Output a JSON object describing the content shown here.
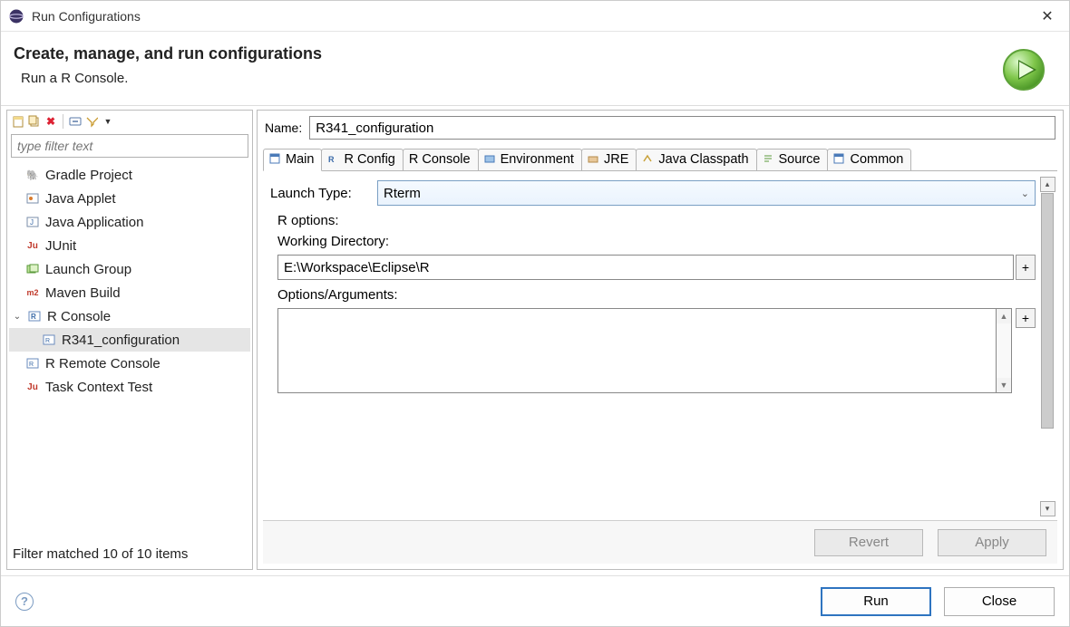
{
  "window": {
    "title": "Run Configurations"
  },
  "header": {
    "title": "Create, manage, and run configurations",
    "subtitle": "Run a R Console."
  },
  "filter": {
    "placeholder": "type filter text",
    "status": "Filter matched 10 of 10 items"
  },
  "tree": {
    "items": [
      {
        "label": "Gradle Project"
      },
      {
        "label": "Java Applet"
      },
      {
        "label": "Java Application"
      },
      {
        "label": "JUnit"
      },
      {
        "label": "Launch Group"
      },
      {
        "label": "Maven Build"
      },
      {
        "label": "R Console",
        "expanded": true,
        "children": [
          {
            "label": "R341_configuration",
            "selected": true
          }
        ]
      },
      {
        "label": "R Remote Console"
      },
      {
        "label": "Task Context Test"
      }
    ]
  },
  "name": {
    "label": "Name:",
    "value": "R341_configuration"
  },
  "tabs": [
    "Main",
    "R Config",
    "R Console",
    "Environment",
    "JRE",
    "Java Classpath",
    "Source",
    "Common"
  ],
  "activeTab": "Main",
  "main": {
    "launchTypeLabel": "Launch Type:",
    "launchTypeValue": "Rterm",
    "rOptionsLabel": "R options:",
    "workingDirLabel": "Working Directory:",
    "workingDirValue": "E:\\Workspace\\Eclipse\\R",
    "optionsArgsLabel": "Options/Arguments:",
    "optionsArgsValue": ""
  },
  "buttons": {
    "revert": "Revert",
    "apply": "Apply",
    "run": "Run",
    "close": "Close"
  }
}
